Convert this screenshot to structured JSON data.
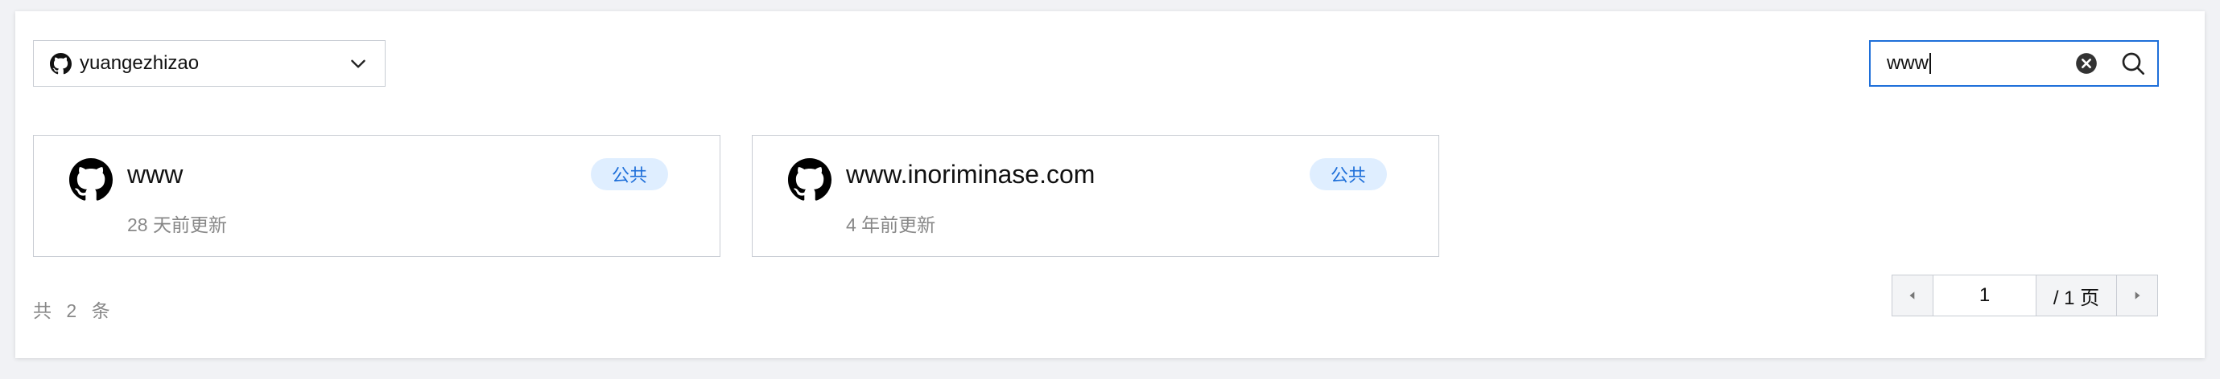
{
  "account_select": {
    "icon": "github-icon",
    "value": "yuangezhizao"
  },
  "search": {
    "value": "www",
    "clear_icon": "clear-circle-icon",
    "search_icon": "search-icon",
    "border_color": "#1e6fd9"
  },
  "repos": [
    {
      "name": "www",
      "updated": "28 天前更新",
      "visibility": "公共",
      "icon": "github-icon"
    },
    {
      "name": "www.inoriminase.com",
      "updated": "4 年前更新",
      "visibility": "公共",
      "icon": "github-icon"
    }
  ],
  "total": "共 2 条",
  "pagination": {
    "current_page": "1",
    "total_pages_label": "/ 1 页"
  },
  "colors": {
    "accent": "#1e6fd9",
    "badge_bg": "#dfeeff",
    "muted_text": "#888888"
  }
}
